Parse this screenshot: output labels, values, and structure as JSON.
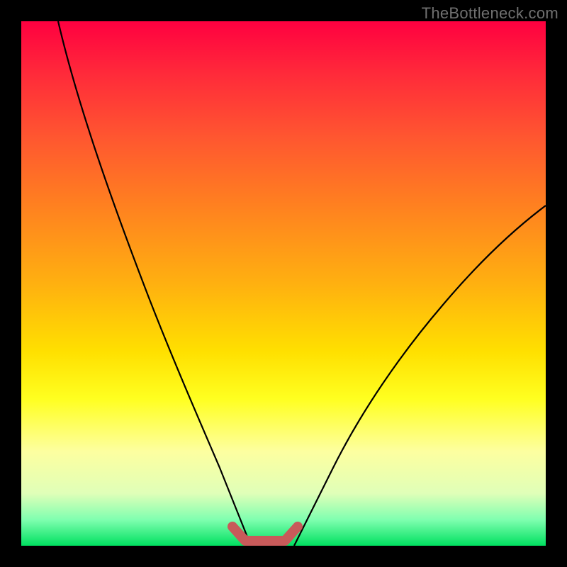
{
  "watermark": "TheBottleneck.com",
  "chart_data": {
    "type": "line",
    "title": "",
    "xlabel": "",
    "ylabel": "",
    "xlim": [
      0,
      100
    ],
    "ylim": [
      0,
      100
    ],
    "grid": false,
    "legend": false,
    "series": [
      {
        "name": "left-curve",
        "x": [
          7,
          12,
          18,
          24,
          30,
          35,
          38,
          41,
          43
        ],
        "y": [
          100,
          82,
          63,
          45,
          27,
          13,
          6,
          2,
          0
        ]
      },
      {
        "name": "right-curve",
        "x": [
          52,
          55,
          60,
          66,
          74,
          83,
          92,
          100
        ],
        "y": [
          0,
          3,
          10,
          20,
          33,
          46,
          57,
          65
        ]
      },
      {
        "name": "trough-highlight",
        "x": [
          40,
          43,
          50,
          53
        ],
        "y": [
          3,
          0,
          0,
          3
        ]
      }
    ],
    "annotations": [],
    "background": "rainbow-vertical-gradient"
  }
}
